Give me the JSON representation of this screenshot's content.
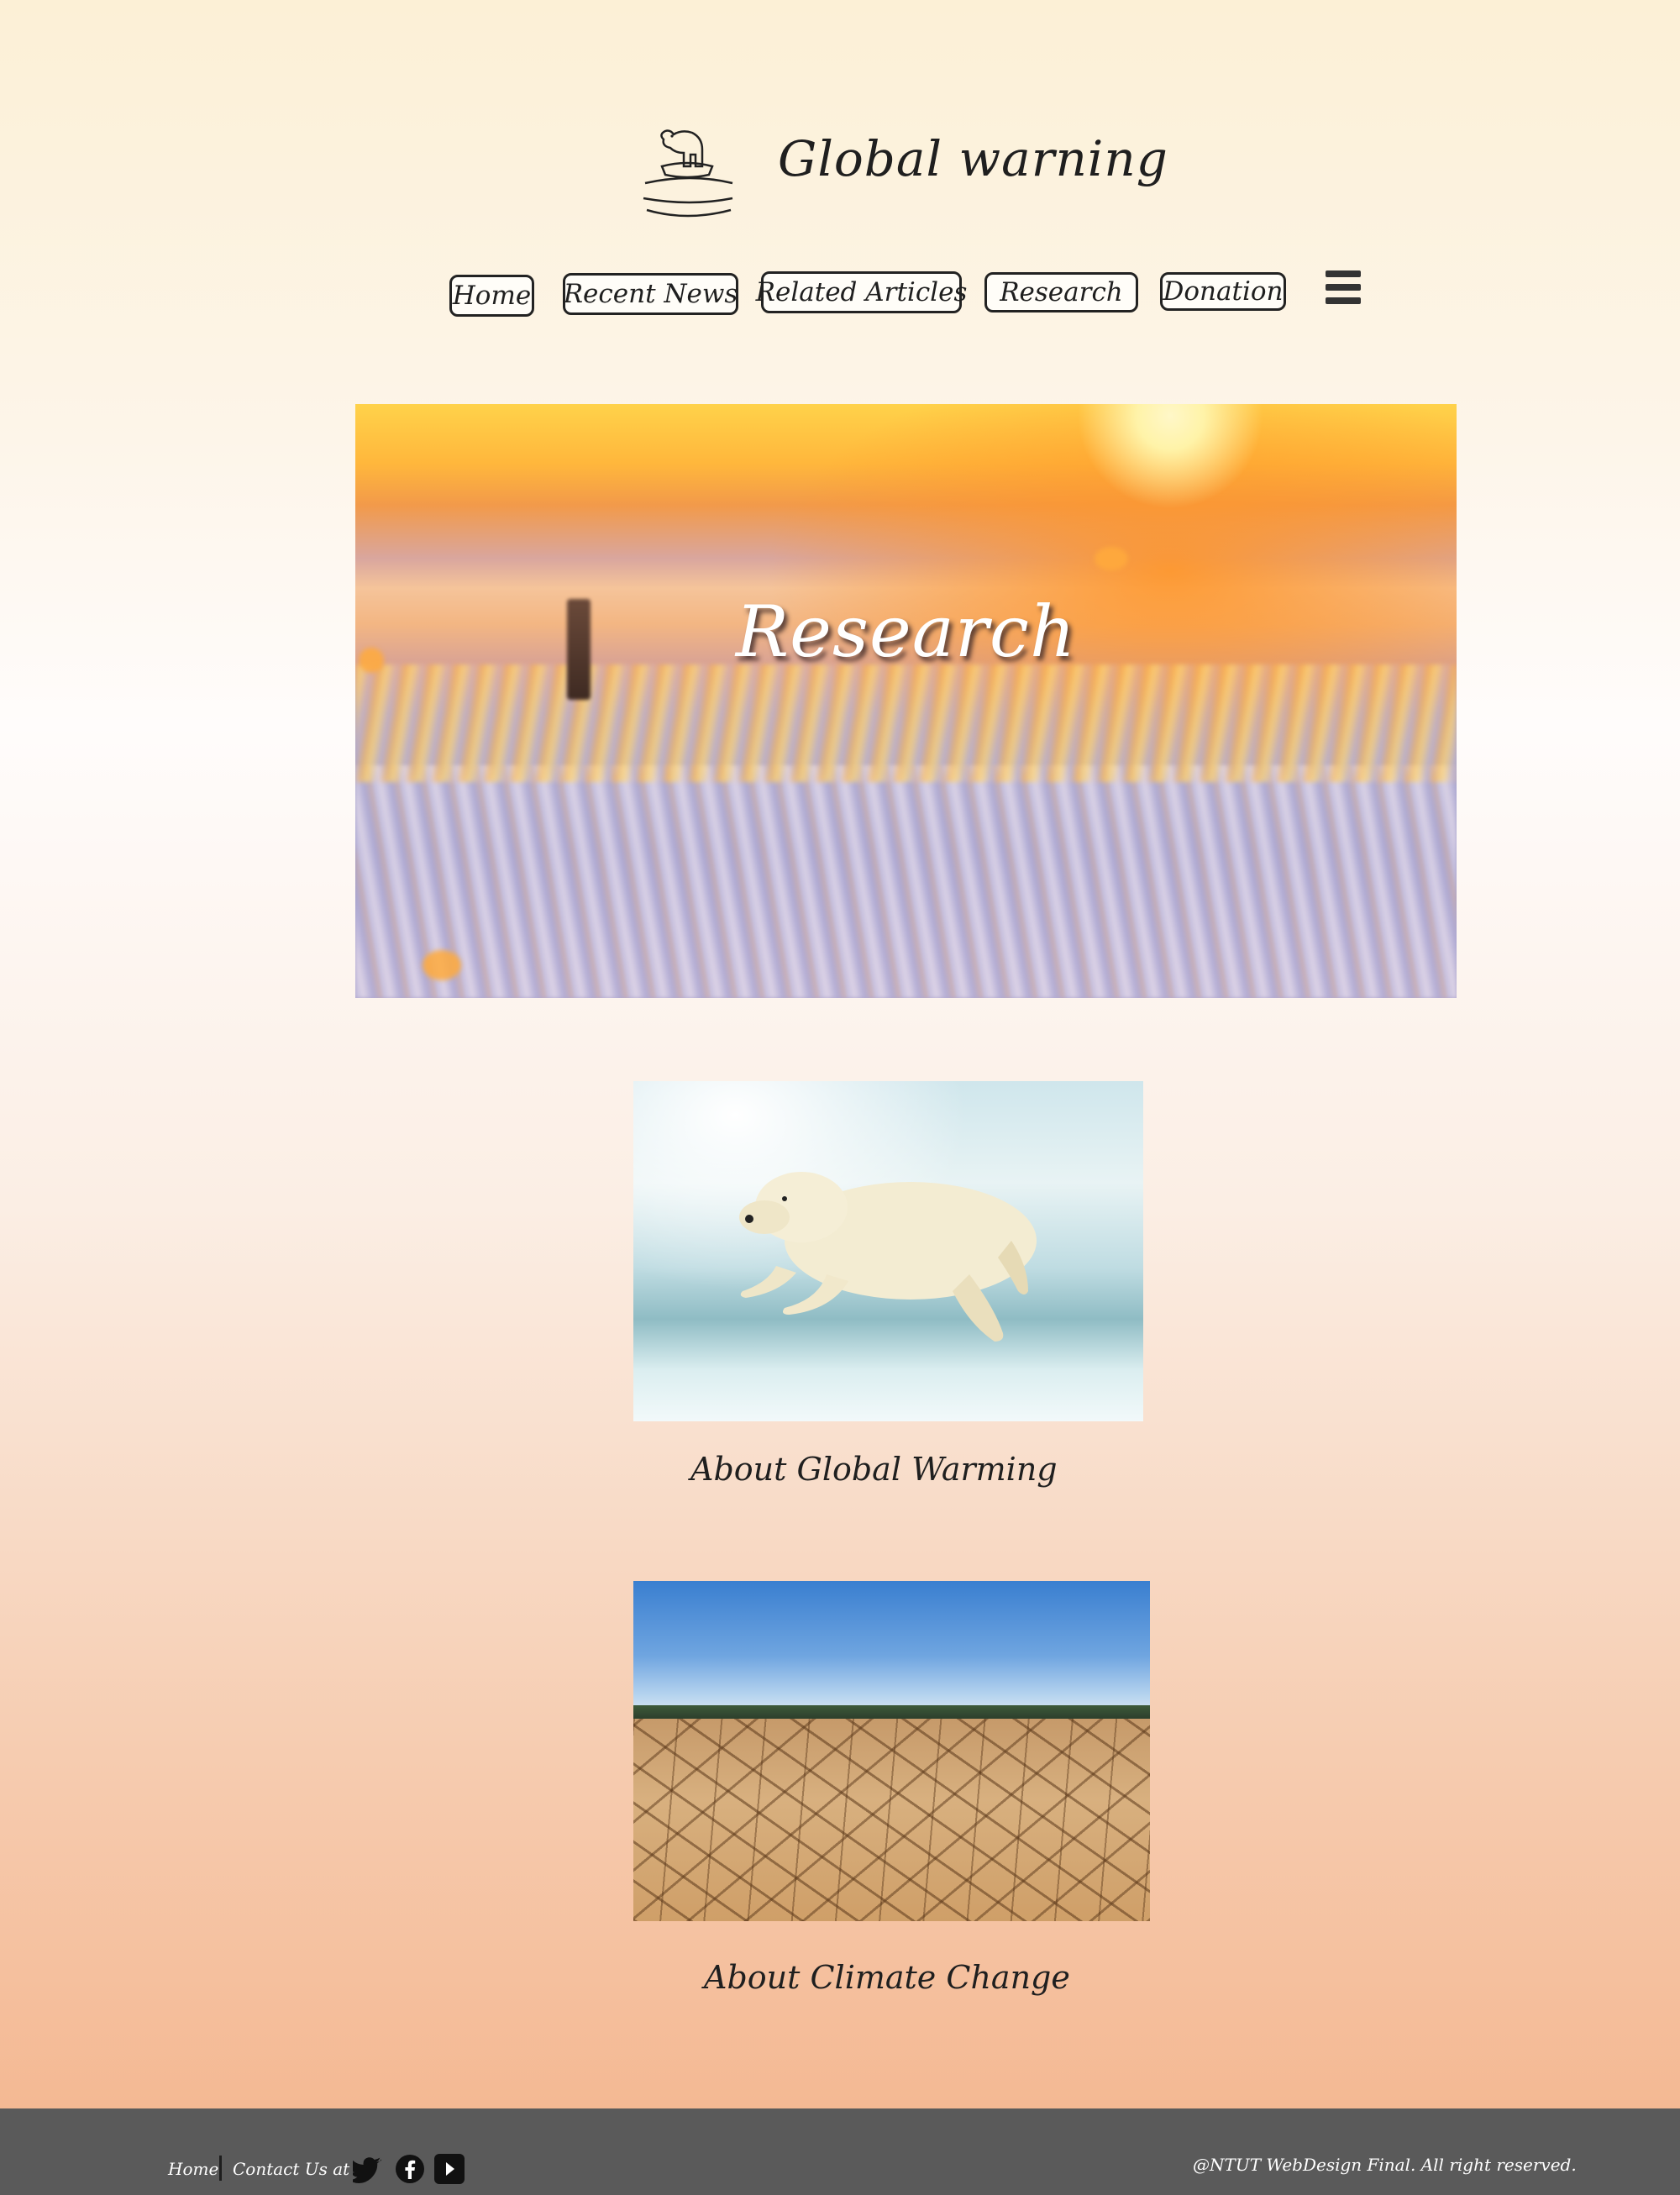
{
  "header": {
    "logo_icon": "polar-bear-on-ice-logo",
    "site_title": "Global warning"
  },
  "nav": {
    "items": [
      {
        "label": "Home"
      },
      {
        "label": "Recent News"
      },
      {
        "label": "Related Articles"
      },
      {
        "label": "Research"
      },
      {
        "label": "Donation"
      }
    ],
    "menu_icon": "hamburger-menu-icon"
  },
  "hero": {
    "title": "Research"
  },
  "cards": [
    {
      "caption": "About Global  Warming",
      "image": "polar-bear-jumping-ice"
    },
    {
      "caption": "About Climate Change",
      "image": "cracked-dry-earth"
    }
  ],
  "footer": {
    "home_label": "Home",
    "contact_label": "Contact Us at",
    "social": [
      "twitter-icon",
      "facebook-icon",
      "play-icon"
    ],
    "copyright": "@NTUT WebDesign Final. All right reserved.",
    "background": "#5a5a5a"
  },
  "colors": {
    "text": "#1f1f1f",
    "nav_border": "#222222",
    "page_top": "#fcf0d6",
    "page_bottom": "#f4b48c"
  }
}
